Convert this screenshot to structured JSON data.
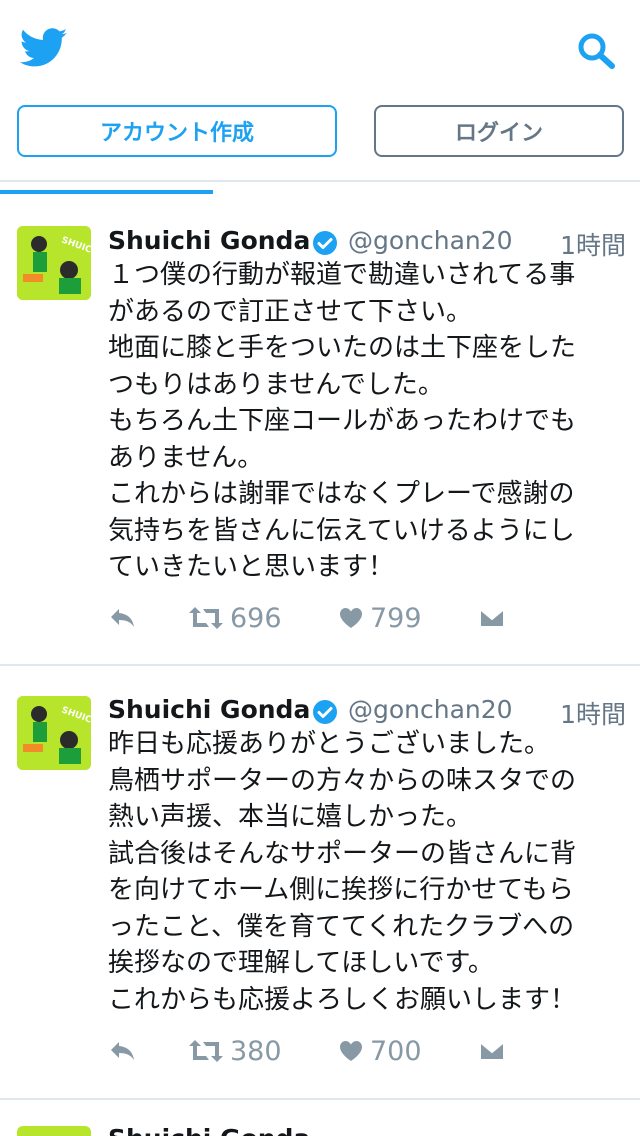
{
  "header": {
    "signup_label": "アカウント作成",
    "login_label": "ログイン"
  },
  "colors": {
    "accent": "#1da1f2",
    "muted": "#657786",
    "icon": "#8899a6",
    "avatar_bg": "#b7e52b"
  },
  "tweets": [
    {
      "name": "Shuichi Gonda",
      "handle": "@gonchan20",
      "time": "1時間",
      "lines": [
        "１つ僕の行動が報道で勘違いされてる事",
        "があるので訂正させて下さい。",
        "地面に膝と手をついたのは土下座をした",
        "つもりはありませんでした。",
        "もちろん土下座コールがあったわけでも",
        "ありません。",
        "これからは謝罪ではなくプレーで感謝の",
        "気持ちを皆さんに伝えていけるようにし",
        "ていきたいと思います！"
      ],
      "retweets": "696",
      "likes": "799"
    },
    {
      "name": "Shuichi Gonda",
      "handle": "@gonchan20",
      "time": "1時間",
      "lines": [
        "昨日も応援ありがとうございました。",
        "鳥栖サポーターの方々からの味スタでの",
        "熱い声援、本当に嬉しかった。",
        "試合後はそんなサポーターの皆さんに背",
        "を向けてホーム側に挨拶に行かせてもら",
        "ったこと、僕を育ててくれたクラブへの",
        "挨拶なので理解してほしいです。",
        "これからも応援よろしくお願いします！"
      ],
      "retweets": "380",
      "likes": "700"
    },
    {
      "name": "Shuichi Gonda",
      "handle": "",
      "time": "",
      "lines": [],
      "retweets": "",
      "likes": ""
    }
  ]
}
